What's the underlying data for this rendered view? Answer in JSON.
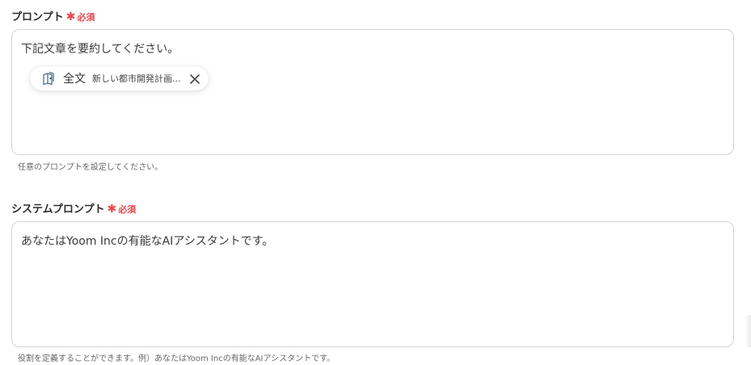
{
  "prompt": {
    "label": "プロンプト",
    "required_star": "✱",
    "required_text": "必須",
    "value": "下記文章を要約してください。",
    "chip": {
      "icon": "book-icon",
      "name": "全文",
      "value": "新しい都市開発計画...",
      "close_icon": "close-icon"
    },
    "help": "任意のプロンプトを設定してください。"
  },
  "system_prompt": {
    "label": "システムプロンプト",
    "required_star": "✱",
    "required_text": "必須",
    "value": "あなたはYoom Incの有能なAIアシスタントです。",
    "help": "役割を定義することができます。例）あなたはYoom Incの有能なAIアシスタントです。"
  },
  "colors": {
    "required": "#e5484d",
    "border": "#cfd3d8",
    "label": "#2b2b2b",
    "help": "#666666",
    "chip_icon": "#4a6f8a"
  }
}
